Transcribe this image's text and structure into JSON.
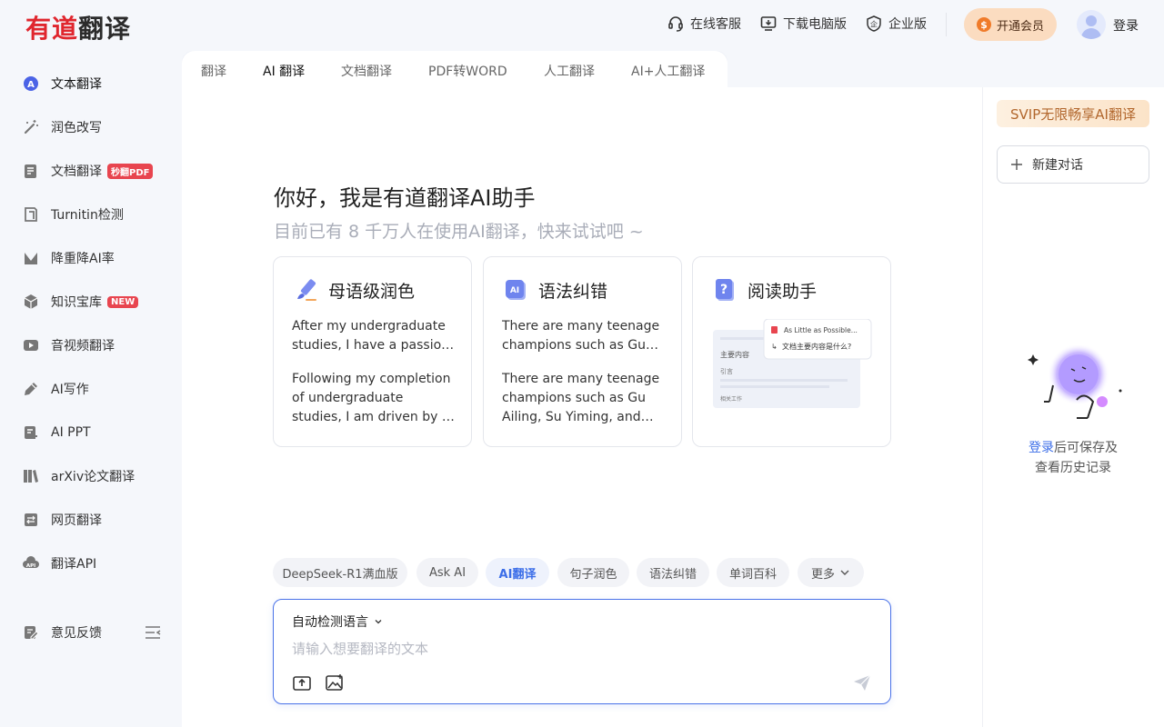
{
  "header": {
    "logo_part1": "有道",
    "logo_part2": "翻译",
    "links": [
      {
        "label": "在线客服",
        "icon": "headset-icon"
      },
      {
        "label": "下载电脑版",
        "icon": "download-icon"
      },
      {
        "label": "企业版",
        "icon": "enterprise-icon"
      }
    ],
    "vip_label": "开通会员",
    "login_label": "登录"
  },
  "sidebar": {
    "items": [
      {
        "label": "文本翻译",
        "icon": "text-translate-icon"
      },
      {
        "label": "润色改写",
        "icon": "magic-wand-icon"
      },
      {
        "label": "文档翻译",
        "icon": "document-icon",
        "badge": "秒翻PDF"
      },
      {
        "label": "Turnitin检测",
        "icon": "turnitin-icon"
      },
      {
        "label": "降重降AI率",
        "icon": "reduce-icon"
      },
      {
        "label": "知识宝库",
        "icon": "cube-icon",
        "badge": "NEW"
      },
      {
        "label": "音视频翻译",
        "icon": "video-icon"
      },
      {
        "label": "AI写作",
        "icon": "pen-icon"
      },
      {
        "label": "AI PPT",
        "icon": "ppt-icon"
      },
      {
        "label": "arXiv论文翻译",
        "icon": "books-icon"
      },
      {
        "label": "网页翻译",
        "icon": "webpage-icon"
      },
      {
        "label": "翻译API",
        "icon": "api-icon"
      }
    ],
    "feedback_label": "意见反馈"
  },
  "tabs": [
    "翻译",
    "AI 翻译",
    "文档翻译",
    "PDF转WORD",
    "人工翻译",
    "AI+人工翻译"
  ],
  "main": {
    "greeting_title": "你好，我是有道翻译AI助手",
    "greeting_sub": "目前已有 8 千万人在使用AI翻译，快来试试吧 ~",
    "cards": [
      {
        "title": "母语级润色",
        "text1": "After my undergraduate studies, I have a passion for",
        "text2": "Following my completion of undergraduate studies, I am driven by a passion"
      },
      {
        "title": "语法纠错",
        "text1": "There are many teenage champions such as Gu Ailing",
        "text2": "There are many teenage champions such as Gu Ailing, Su Yiming, and others"
      },
      {
        "title": "阅读助手",
        "preview_line1": "As Little as Possible...",
        "preview_line2": "文档主要内容是什么?",
        "preview_left1": "主要内容",
        "preview_left2": "引言",
        "preview_left3": "相关工作"
      }
    ],
    "chips": [
      "DeepSeek-R1满血版",
      "Ask AI",
      "AI翻译",
      "句子润色",
      "语法纠错",
      "单词百科",
      "更多"
    ],
    "input": {
      "lang_label": "自动检测语言",
      "placeholder": "请输入想要翻译的文本"
    }
  },
  "right_panel": {
    "svip_label": "SVIP无限畅享AI翻译",
    "new_chat_label": "新建对话",
    "login_link": "登录",
    "empty_text1": "后可保存及",
    "empty_text2": "查看历史记录"
  }
}
